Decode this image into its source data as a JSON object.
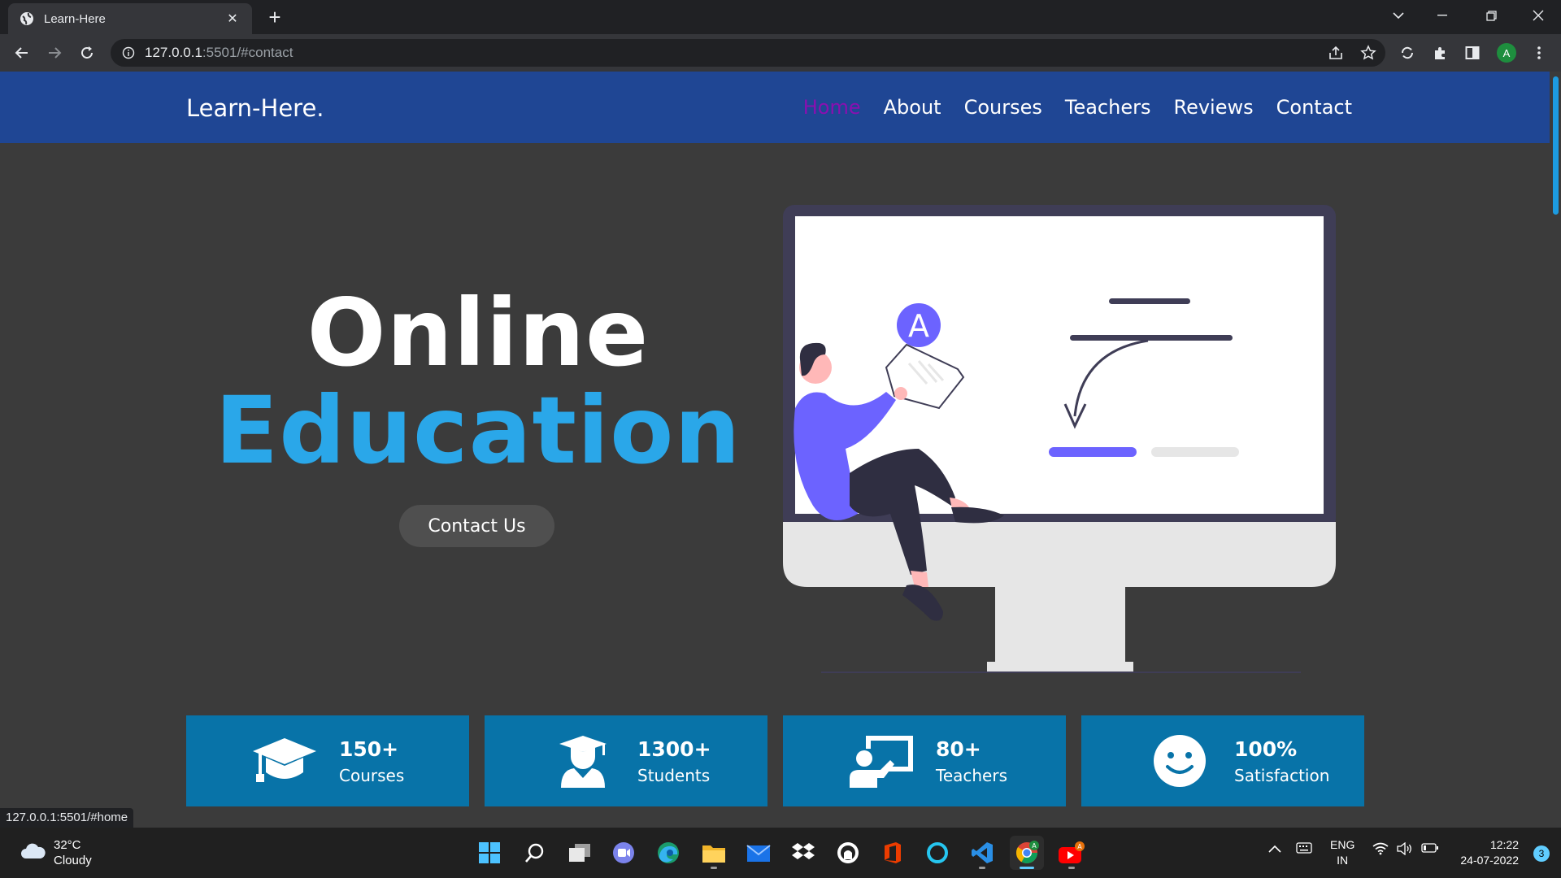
{
  "browser": {
    "tab_title": "Learn-Here",
    "url_host": "127.0.0.1",
    "url_path": ":5501/#contact",
    "status_url": "127.0.0.1:5501/#home",
    "profile_initial": "A"
  },
  "site": {
    "logo": "Learn-Here.",
    "nav": [
      {
        "label": "Home",
        "active": true
      },
      {
        "label": "About"
      },
      {
        "label": "Courses"
      },
      {
        "label": "Teachers"
      },
      {
        "label": "Reviews"
      },
      {
        "label": "Contact"
      }
    ],
    "hero": {
      "title_line1": "Online",
      "title_line2": "Education",
      "cta_label": "Contact Us"
    },
    "illustration": {
      "letter": "A"
    },
    "stats": [
      {
        "value": "150+",
        "label": "Courses",
        "icon": "graduation-cap-icon"
      },
      {
        "value": "1300+",
        "label": "Students",
        "icon": "student-icon"
      },
      {
        "value": "80+",
        "label": "Teachers",
        "icon": "teacher-board-icon"
      },
      {
        "value": "100%",
        "label": "Satisfaction",
        "icon": "smiley-icon"
      }
    ]
  },
  "taskbar": {
    "weather_temp": "32°C",
    "weather_desc": "Cloudy",
    "lang_line1": "ENG",
    "lang_line2": "IN",
    "time": "12:22",
    "date": "24-07-2022",
    "notification_count": "3",
    "youtube_badge": "A",
    "chrome_badge": "A"
  },
  "colors": {
    "header_bg": "#1f4694",
    "accent_blue": "#2aa7e9",
    "stat_bg": "#0873a8",
    "active_nav": "#8a0fb0",
    "page_bg": "#3b3b3b"
  }
}
